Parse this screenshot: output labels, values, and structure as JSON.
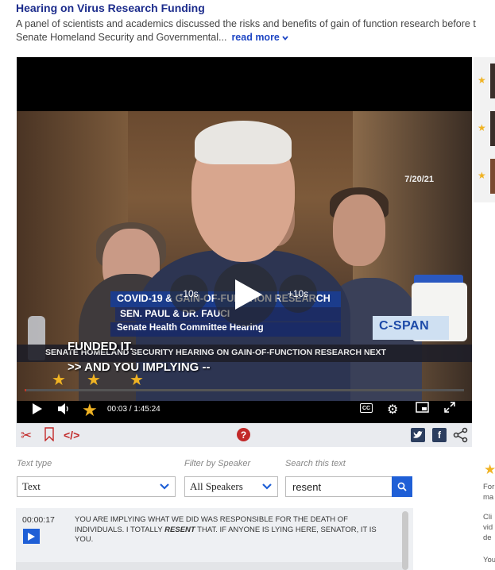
{
  "header": {
    "title": "Hearing on Virus Research Funding",
    "description_line1": "A panel of scientists and academics discussed the risks and benefits of gain of function research before t",
    "description_line2": "Senate Homeland Security and Governmental...",
    "read_more": "read more"
  },
  "video": {
    "date": "7/20/21",
    "lower_third_title": "COVID-19 & GAIN-OF-FUNCTION RESEARCH",
    "lower_third_name": "SEN. PAUL & DR. FAUCI",
    "lower_third_sub": "Senate Health Committee Hearing",
    "network": "C-SPAN",
    "ticker": "SENATE HOMELAND SECURITY HEARING ON GAIN-OF-FUNCTION RESEARCH NEXT",
    "caption_line1": "FUNDED IT.",
    "caption_line2": ">> AND YOU IMPLYING --",
    "skip_back": "-10s",
    "skip_forward": "+10s",
    "current_time": "00:03",
    "duration": "1:45:24",
    "cc_label": "CC"
  },
  "filters": {
    "text_type_label": "Text type",
    "text_type_value": "Text",
    "speaker_label": "Filter by Speaker",
    "speaker_value": "All Speakers",
    "search_label": "Search this text",
    "search_value": "resent"
  },
  "transcript": {
    "entries": [
      {
        "time": "00:00:17",
        "text_before": "You are implying what we did was responsible for the death of individuals. I totally ",
        "highlight": "resent",
        "text_after": " that. If anyone is lying here, senator, it is you."
      }
    ]
  },
  "right_sidebar": {
    "lines": [
      "For",
      "ma",
      "Cli",
      "vid",
      "de",
      "You"
    ]
  },
  "colors": {
    "title": "#1c2c8c",
    "accent_blue": "#1f5fd6",
    "accent_red": "#c22929",
    "star": "#f0b323"
  },
  "icons": [
    "play-icon",
    "volume-icon",
    "star-icon",
    "cc-icon",
    "gear-icon",
    "pip-icon",
    "fullscreen-icon",
    "scissors-icon",
    "bookmark-icon",
    "embed-icon",
    "help-icon",
    "twitter-icon",
    "facebook-icon",
    "share-icon",
    "chevron-down-icon",
    "search-icon"
  ]
}
